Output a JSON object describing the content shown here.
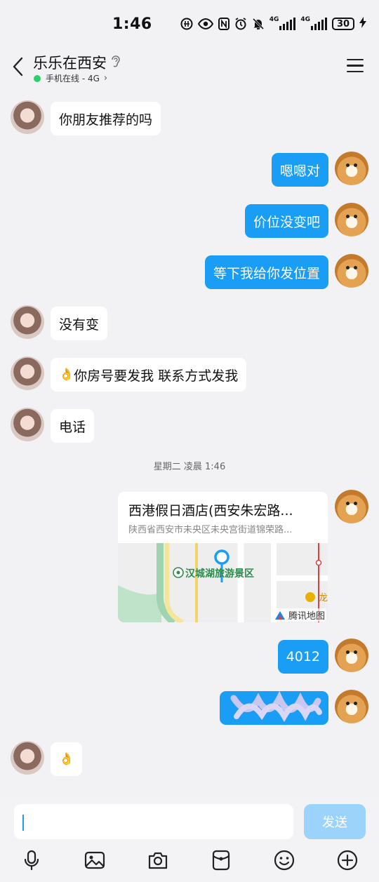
{
  "status_bar": {
    "time": "1:46",
    "net1": "4G",
    "net2": "4G",
    "battery": "30"
  },
  "header": {
    "contact_name": "乐乐在西安",
    "online_status": "手机在线 - 4G"
  },
  "messages": [
    {
      "side": "in",
      "text": "你朋友推荐的吗"
    },
    {
      "side": "out",
      "text": "嗯嗯对"
    },
    {
      "side": "out",
      "text": "价位没变吧"
    },
    {
      "side": "out",
      "text": "等下我给你发位置"
    },
    {
      "side": "in",
      "text": "没有变"
    },
    {
      "side": "in",
      "emoji": "👌",
      "text": " 你房号要发我  联系方式发我"
    },
    {
      "side": "in",
      "text": "电话"
    },
    {
      "side": "out",
      "text": "4012"
    },
    {
      "side": "in",
      "emoji": "👌"
    }
  ],
  "timestamp": "星期二 凌晨 1:46",
  "location": {
    "title": "西港假日酒店(西安朱宏路...",
    "address": "陕西省西安市未央区未央宫街道锦荣路...",
    "map_poi": "汉城湖旅游景区",
    "map_edge": "龙",
    "map_brand": "腾讯地图"
  },
  "input": {
    "value": "",
    "send_label": "发送"
  },
  "toolbar": [
    "microphone-icon",
    "image-icon",
    "camera-icon",
    "red-packet-icon",
    "emoji-icon",
    "plus-icon"
  ],
  "colors": {
    "accent": "#1a9ef5",
    "send_disabled": "#9bd3fa",
    "online": "#2bcf6b",
    "background": "#f2f2f5"
  }
}
